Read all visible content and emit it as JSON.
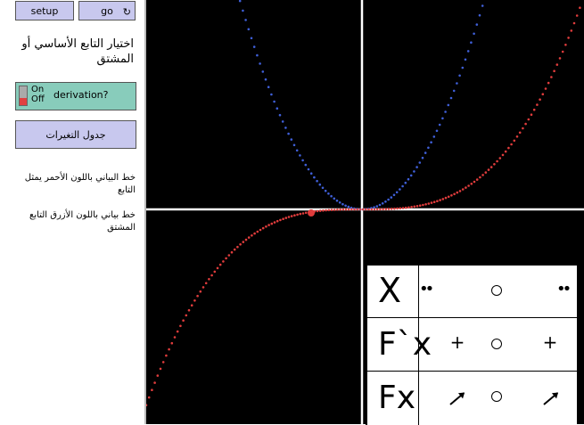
{
  "controls": {
    "setup_label": "setup",
    "go_label": "go",
    "go_icon": "refresh-icon",
    "chooser_label": "اختيار التابع الأساسي أو المشتق",
    "switch_on": "On",
    "switch_off": "Off",
    "switch_name": "derivation?",
    "table_button_label": "جدول التغيرات"
  },
  "notes": {
    "red_curve": "خط البياني باللون الأحمر يمثل التابع",
    "blue_curve": "خط بياني باللون الأزرق التابع المشتق"
  },
  "variation_table": {
    "row_x_label": "X",
    "row_fprime_label": "F`x",
    "row_f_label": "Fx",
    "row_x_values": [
      "••",
      "○",
      "••"
    ],
    "row_fprime_values": [
      "+",
      "○",
      "+"
    ],
    "row_f_values": [
      "↗",
      "○",
      "↗"
    ]
  },
  "colors": {
    "function_curve": "#e03c3c",
    "derivative_curve": "#3f5fd8",
    "axes": "#ffffff",
    "button_bg": "#c8c8ee",
    "switch_bg": "#88ccbb"
  },
  "chart_data": {
    "type": "scatter",
    "series": [
      {
        "function": "x^3",
        "color": "#e03c3c"
      },
      {
        "function": "3x^2",
        "color": "#3f5fd8"
      }
    ],
    "highlighted_point_color": "#e03c3c"
  }
}
